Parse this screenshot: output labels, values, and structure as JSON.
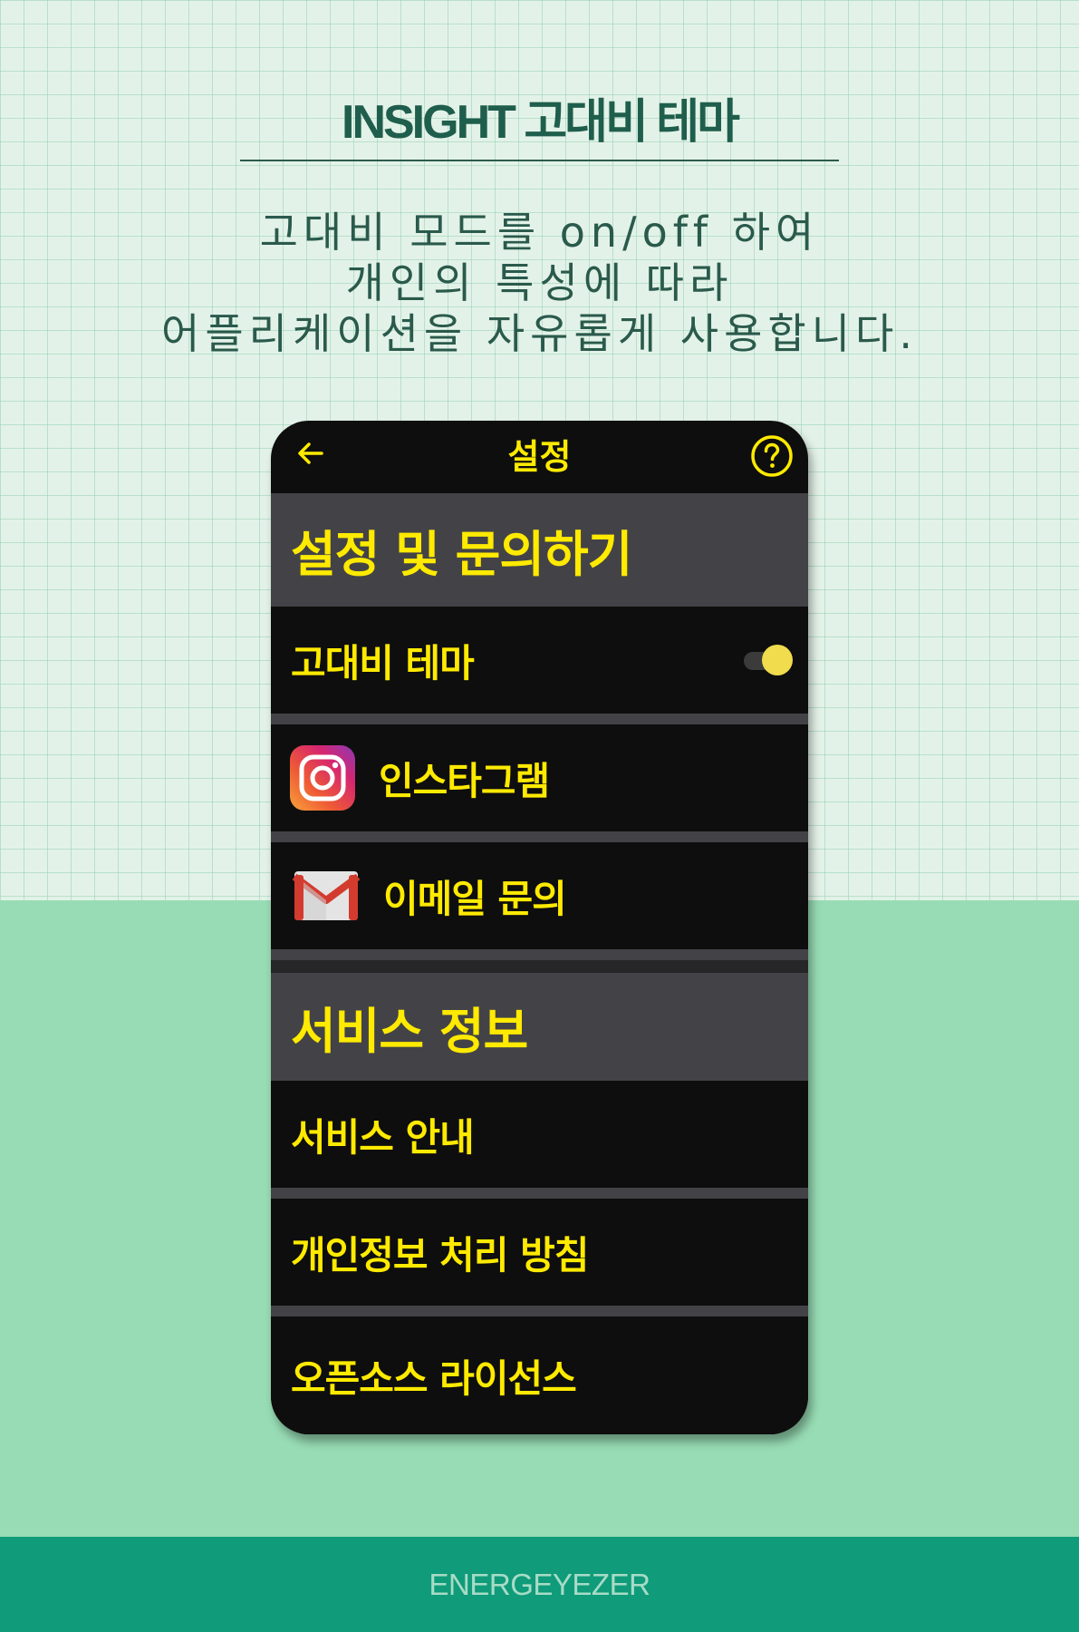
{
  "header": {
    "title": "INSIGHT 고대비 테마",
    "description_lines": [
      "고대비 모드를 on/off 하여",
      "개인의 특성에 따라",
      "어플리케이션을 자유롭게 사용합니다."
    ]
  },
  "phone": {
    "appbar": {
      "title": "설정",
      "back_icon": "back-arrow-icon",
      "help_icon": "help-circle-icon"
    },
    "sections": [
      {
        "title": "설정 및 문의하기",
        "items": [
          {
            "label": "고대비 테마",
            "control": "toggle",
            "toggle_on": true
          },
          {
            "label": "인스타그램",
            "icon": "instagram-icon"
          },
          {
            "label": "이메일 문의",
            "icon": "gmail-icon"
          }
        ]
      },
      {
        "title": "서비스 정보",
        "items": [
          {
            "label": "서비스 안내"
          },
          {
            "label": "개인정보 처리 방침"
          },
          {
            "label": "오픈소스 라이선스"
          }
        ]
      }
    ]
  },
  "footer": {
    "brand": "ENERGEYEZER"
  },
  "colors": {
    "accent_yellow": "#ffea00",
    "app_background": "#0e0e0e",
    "section_background": "#434347",
    "page_top": "#e3f2e8",
    "page_bottom": "#97dcb4",
    "footer": "#109b7a",
    "title_text": "#1f5e4c"
  }
}
